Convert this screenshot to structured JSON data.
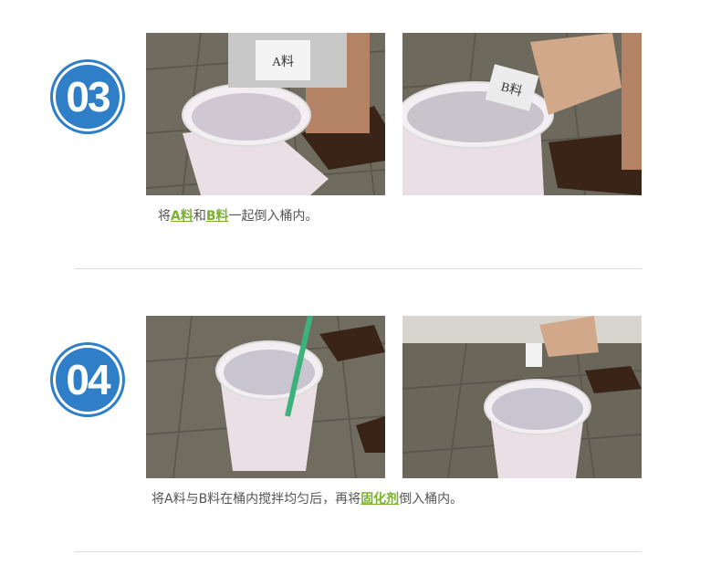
{
  "colors": {
    "badge": "#2f7fc8",
    "highlight": "#7bb32e",
    "caption": "#555555",
    "divider": "#dddddd"
  },
  "steps": [
    {
      "number": "03",
      "photos": [
        {
          "label": "A料",
          "icon": "pouring-bag-into-bucket-photo"
        },
        {
          "label": "B料",
          "icon": "pouring-bag-into-bucket-photo"
        }
      ],
      "caption": {
        "pre": "将",
        "hl1": "A料",
        "mid": "和",
        "hl2": "B料",
        "post": "一起倒入桶内。"
      }
    },
    {
      "number": "04",
      "photos": [
        {
          "label": "",
          "icon": "stirring-bucket-photo"
        },
        {
          "label": "",
          "icon": "pouring-bottle-into-bucket-photo"
        }
      ],
      "caption": {
        "pre": "将A料与B料在桶内搅拌均匀后，再将",
        "hl1": "固化剂",
        "post": "倒入桶内。"
      }
    }
  ]
}
